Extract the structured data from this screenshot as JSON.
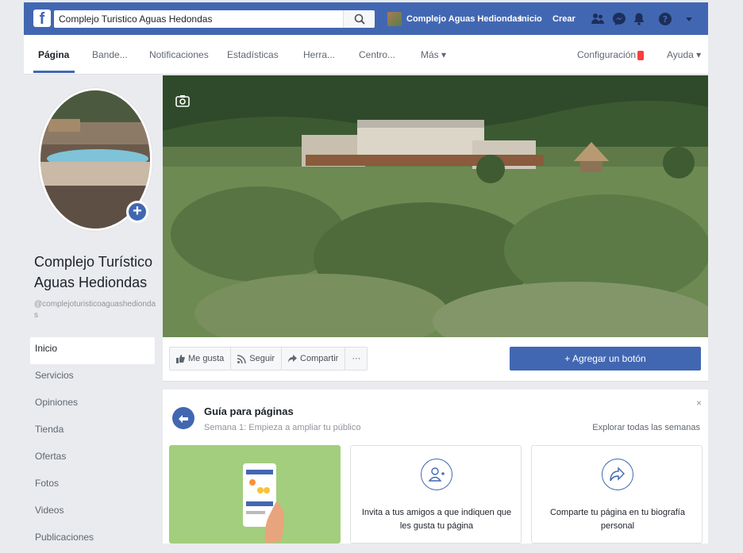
{
  "topbar": {
    "logo": "f",
    "search_value": "Complejo Turistico Aguas Hedondas",
    "page_chip": "Complejo Aguas Hediondas",
    "nav": [
      "Inicio",
      "Crear"
    ],
    "icons": [
      "friends-icon",
      "messenger-icon",
      "notifications-icon",
      "help-icon",
      "caret-down-icon"
    ],
    "color": "#4267b2"
  },
  "tabs": {
    "items": [
      "Página",
      "Bande...",
      "Notificaciones",
      "Estadísticas",
      "Herra...",
      "Centro...",
      "Más ▾"
    ],
    "right": [
      "Configuración",
      "Ayuda ▾"
    ],
    "config_badge_color": "#fa3e3e"
  },
  "profile": {
    "name": "Complejo Turístico Aguas Hediondas",
    "handle": "@complejoturisticoaguashediondas",
    "add_symbol": "+"
  },
  "leftnav": [
    "Inicio",
    "Servicios",
    "Opiniones",
    "Tienda",
    "Ofertas",
    "Fotos",
    "Videos",
    "Publicaciones"
  ],
  "actions": {
    "like": "Me gusta",
    "follow": "Seguir",
    "share": "Compartir",
    "more": "···",
    "cta": "+ Agregar un botón"
  },
  "guide": {
    "title": "Guía para páginas",
    "subtitle": "Semana 1: Empieza a ampliar tu público",
    "link": "Explorar todas las semanas",
    "close": "×",
    "cards": [
      {
        "text": ""
      },
      {
        "text": "Invita a tus amigos a que indiquen que les gusta tu página"
      },
      {
        "text": "Comparte tu página en tu biografía personal"
      }
    ]
  }
}
